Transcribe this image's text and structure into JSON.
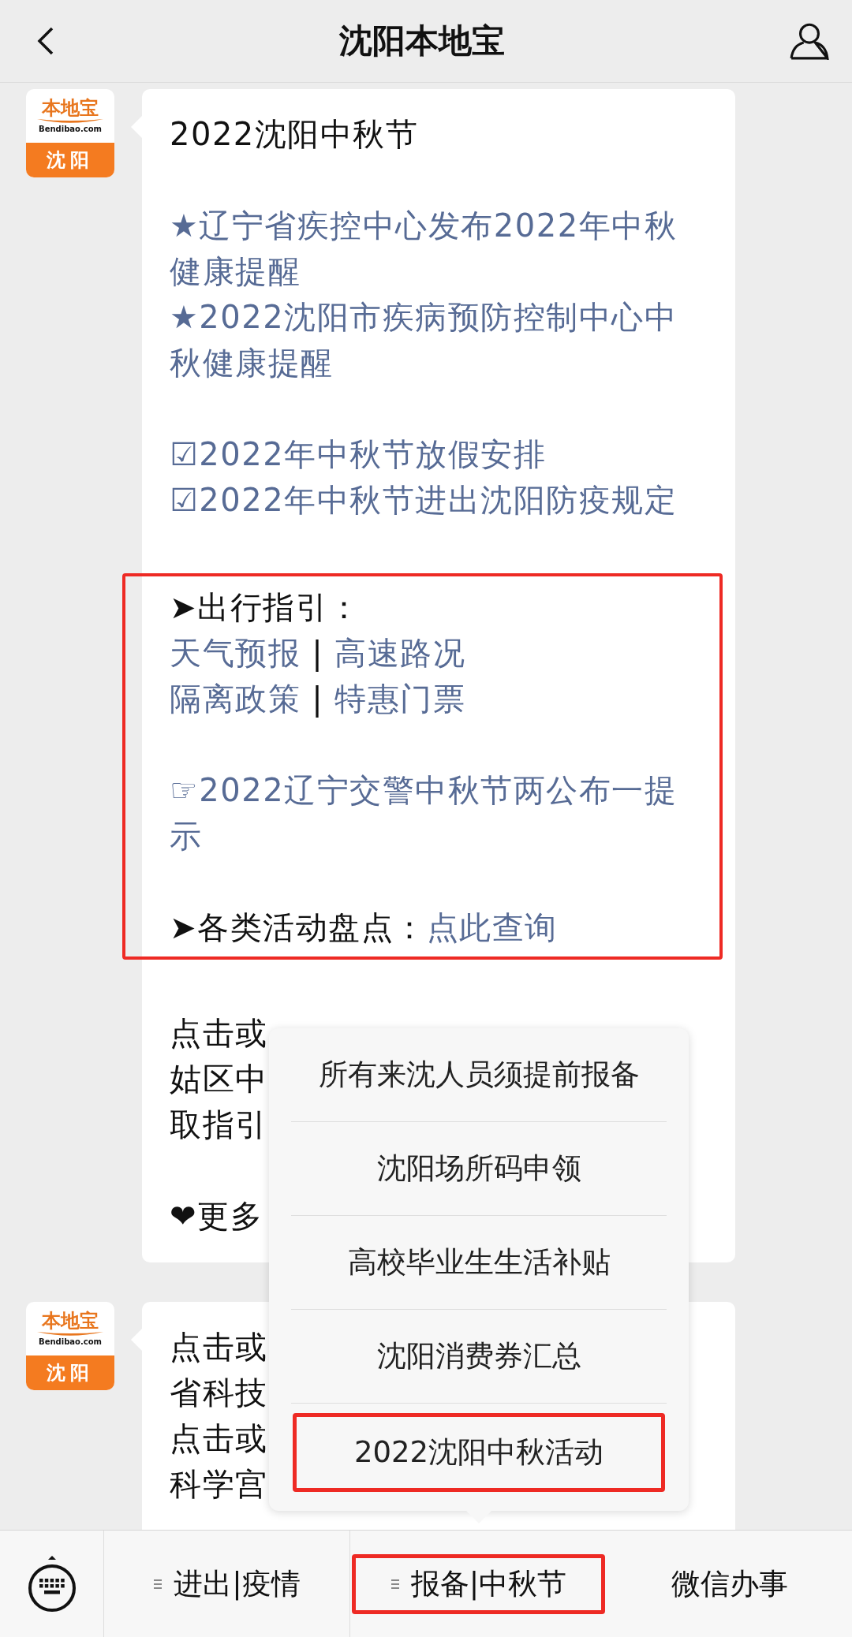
{
  "header": {
    "title": "沈阳本地宝"
  },
  "messages": [
    {
      "avatar": {
        "brand": "本地宝",
        "domain": "Bendibao.com",
        "city": "沈阳"
      },
      "sections": [
        {
          "highlighted": false,
          "blocks": [
            {
              "kind": "title",
              "parts": [
                {
                  "kind": "text",
                  "text": "2022沈阳中秋节"
                }
              ]
            },
            {
              "kind": "spacer"
            },
            {
              "kind": "line",
              "parts": [
                {
                  "kind": "symbol",
                  "text": "★"
                },
                {
                  "kind": "link",
                  "text": "辽宁省疾控中心发布2022年中秋健康提醒"
                }
              ]
            },
            {
              "kind": "line",
              "parts": [
                {
                  "kind": "symbol",
                  "text": "★"
                },
                {
                  "kind": "link",
                  "text": "2022沈阳市疾病预防控制中心中秋健康提醒"
                }
              ]
            },
            {
              "kind": "spacer"
            },
            {
              "kind": "line",
              "parts": [
                {
                  "kind": "symbol",
                  "text": "☑"
                },
                {
                  "kind": "link",
                  "text": "2022年中秋节放假安排"
                }
              ]
            },
            {
              "kind": "line",
              "parts": [
                {
                  "kind": "symbol",
                  "text": "☑"
                },
                {
                  "kind": "link",
                  "text": "2022年中秋节进出沈阳防疫规定"
                }
              ]
            },
            {
              "kind": "spacer"
            }
          ]
        },
        {
          "highlighted": true,
          "blocks": [
            {
              "kind": "line",
              "parts": [
                {
                  "kind": "symbol",
                  "text": "➤"
                },
                {
                  "kind": "text",
                  "text": "出行指引："
                }
              ]
            },
            {
              "kind": "line",
              "parts": [
                {
                  "kind": "link",
                  "text": "天气预报"
                },
                {
                  "kind": "text",
                  "text": " | "
                },
                {
                  "kind": "link",
                  "text": "高速路况"
                }
              ]
            },
            {
              "kind": "line",
              "parts": [
                {
                  "kind": "link",
                  "text": "隔离政策"
                },
                {
                  "kind": "text",
                  "text": " | "
                },
                {
                  "kind": "link",
                  "text": "特惠门票"
                }
              ]
            },
            {
              "kind": "spacer"
            },
            {
              "kind": "line",
              "parts": [
                {
                  "kind": "symbol",
                  "text": "☞"
                },
                {
                  "kind": "link",
                  "text": "2022辽宁交警中秋节两公布一提示"
                }
              ]
            },
            {
              "kind": "spacer"
            },
            {
              "kind": "line",
              "parts": [
                {
                  "kind": "symbol",
                  "text": "➤"
                },
                {
                  "kind": "text",
                  "text": "各类活动盘点："
                },
                {
                  "kind": "link",
                  "text": "点此查询"
                }
              ]
            }
          ]
        },
        {
          "highlighted": false,
          "blocks": [
            {
              "kind": "spacer"
            },
            {
              "kind": "line",
              "parts": [
                {
                  "kind": "text",
                  "text": "点击或"
                }
              ]
            },
            {
              "kind": "line",
              "parts": [
                {
                  "kind": "text",
                  "text": "姑区中"
                }
              ]
            },
            {
              "kind": "line",
              "parts": [
                {
                  "kind": "text",
                  "text": "取指引"
                }
              ]
            },
            {
              "kind": "spacer"
            },
            {
              "kind": "line",
              "parts": [
                {
                  "kind": "symbol",
                  "text": "❤"
                },
                {
                  "kind": "text",
                  "text": "更多"
                }
              ]
            }
          ]
        }
      ]
    },
    {
      "avatar": {
        "brand": "本地宝",
        "domain": "Bendibao.com",
        "city": "沈阳"
      },
      "sections": [
        {
          "highlighted": false,
          "blocks": [
            {
              "kind": "line",
              "parts": [
                {
                  "kind": "text",
                  "text": "点击或"
                }
              ]
            },
            {
              "kind": "line",
              "parts": [
                {
                  "kind": "text",
                  "text": "省科技"
                }
              ]
            },
            {
              "kind": "line",
              "parts": [
                {
                  "kind": "text",
                  "text": "点击或"
                }
              ]
            },
            {
              "kind": "line",
              "parts": [
                {
                  "kind": "text",
                  "text": "科学宫"
                }
              ]
            },
            {
              "kind": "spacer"
            },
            {
              "kind": "spacer"
            }
          ]
        }
      ]
    }
  ],
  "popup_menu": {
    "items": [
      {
        "label": "所有来沈人员须提前报备",
        "selected": false
      },
      {
        "label": "沈阳场所码申领",
        "selected": false
      },
      {
        "label": "高校毕业生生活补贴",
        "selected": false
      },
      {
        "label": "沈阳消费券汇总",
        "selected": false
      },
      {
        "label": "2022沈阳中秋活动",
        "selected": true
      }
    ]
  },
  "bottom_menu": {
    "tabs": [
      {
        "label": "进出|疫情",
        "has_submenu": true,
        "selected": false
      },
      {
        "label": "报备|中秋节",
        "has_submenu": true,
        "selected": true
      },
      {
        "label": "微信办事",
        "has_submenu": false,
        "selected": false
      }
    ]
  }
}
